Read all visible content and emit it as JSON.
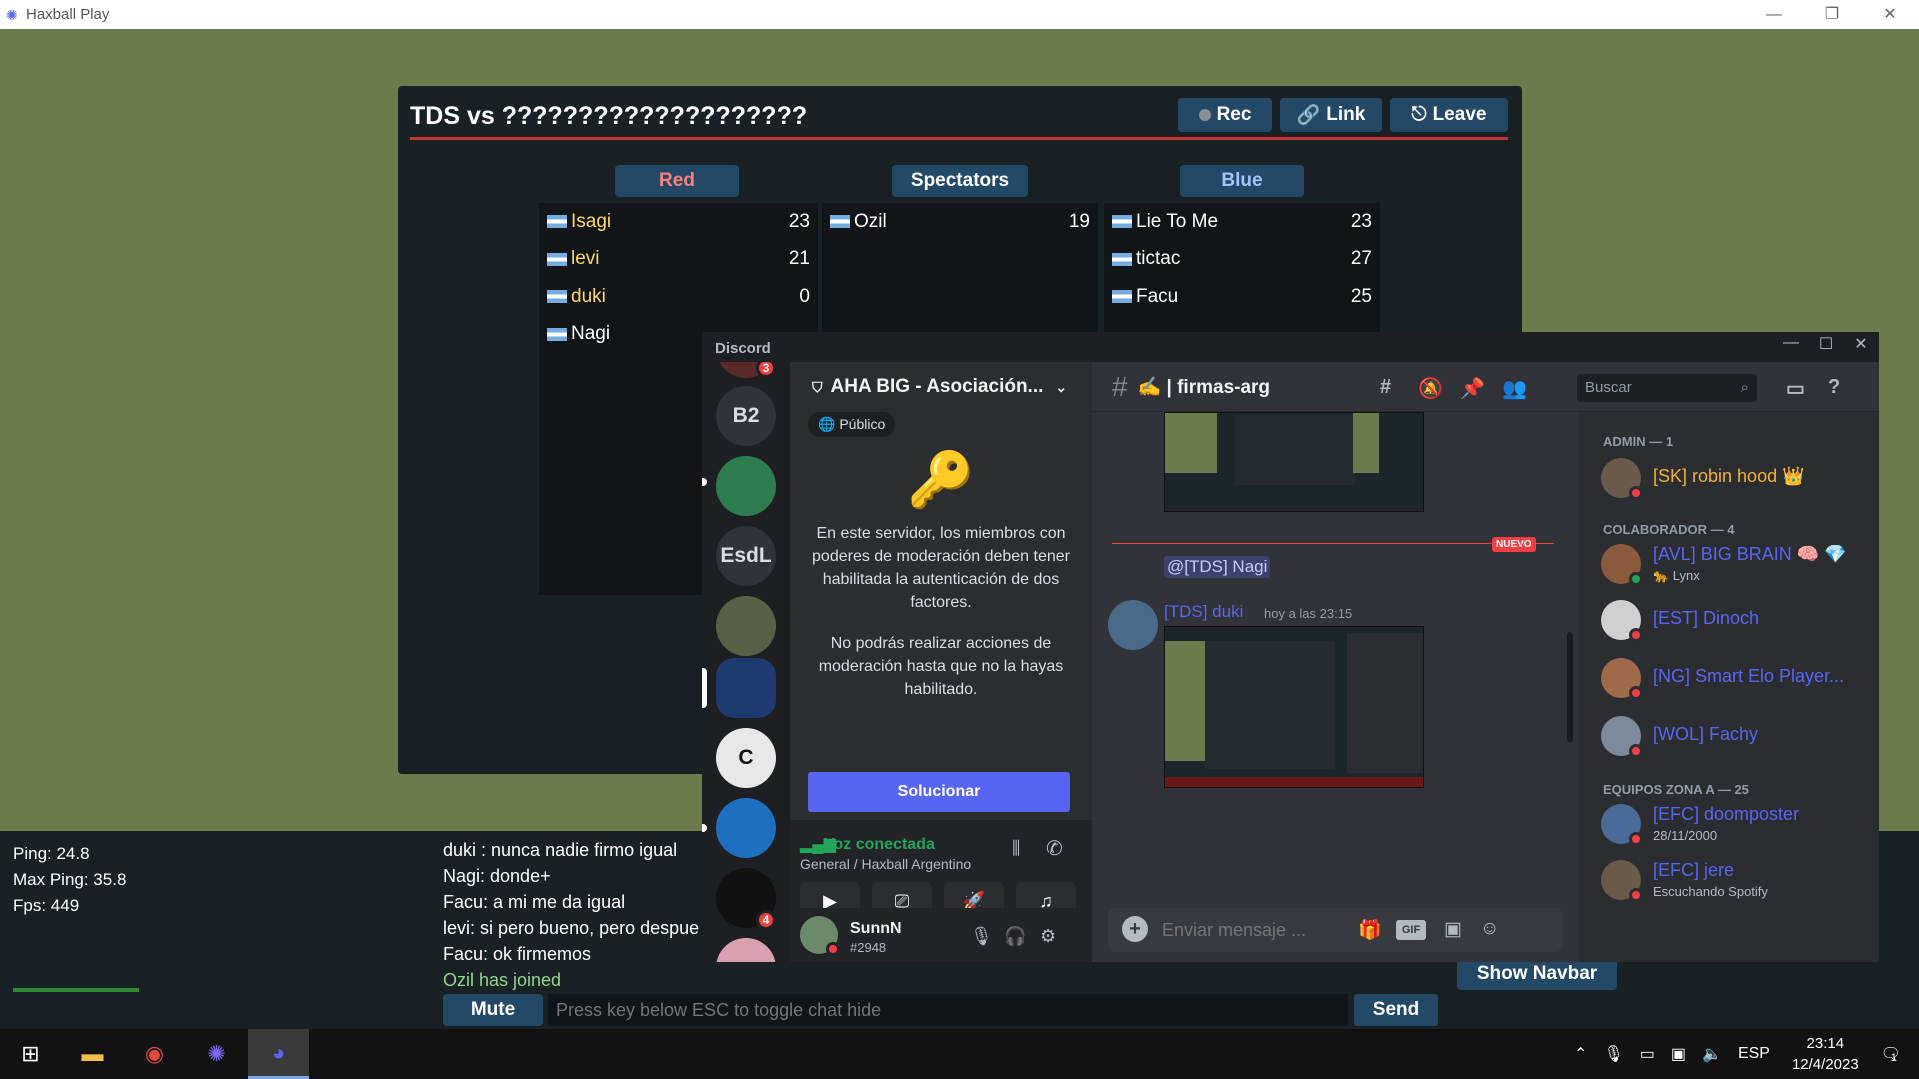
{
  "window": {
    "title": "Haxball Play",
    "controls": [
      "—",
      "❐",
      "✕"
    ]
  },
  "room": {
    "title": "TDS vs ????????????????????",
    "buttons": {
      "rec": "Rec",
      "link": "Link",
      "leave": "Leave"
    },
    "teams": {
      "red": {
        "label": "Red",
        "color": "#ff7f7f",
        "players": [
          {
            "name": "Isagi",
            "value": "23"
          },
          {
            "name": "levi",
            "value": "21"
          },
          {
            "name": "duki",
            "value": "0"
          },
          {
            "name": "Nagi",
            "value": ""
          }
        ]
      },
      "spectators": {
        "label": "Spectators",
        "color": "#ffffff",
        "players": [
          {
            "name": "Ozil",
            "value": "19"
          }
        ]
      },
      "blue": {
        "label": "Blue",
        "color": "#a2c4ff",
        "players": [
          {
            "name": "Lie To Me",
            "value": "23"
          },
          {
            "name": "tictac",
            "value": "27"
          },
          {
            "name": "Facu",
            "value": "25"
          }
        ]
      }
    }
  },
  "hud": {
    "stats": [
      "Ping: 24.8",
      "Max Ping: 35.8",
      "Fps: 449"
    ],
    "chat": [
      {
        "text": "duki : nunca nadie firmo igual",
        "system": false
      },
      {
        "text": "Nagi: donde+",
        "system": false
      },
      {
        "text": "Facu: a mi me da igual",
        "system": false
      },
      {
        "text": "levi: si pero bueno, pero despue",
        "system": false
      },
      {
        "text": "Facu: ok firmemos",
        "system": false
      },
      {
        "text": "Ozil has joined",
        "system": true
      }
    ],
    "mute": "Mute",
    "input_placeholder": "Press key below ESC to toggle chat hide",
    "send": "Send",
    "show_navbar": "Show Navbar"
  },
  "discord": {
    "app_name": "Discord",
    "servers": [
      {
        "label": "B2",
        "color": "#313338",
        "badge": ""
      },
      {
        "label": "",
        "color": "#2e7d4f",
        "badge": ""
      },
      {
        "label": "EsdL",
        "color": "#313338",
        "badge": ""
      },
      {
        "label": "",
        "color": "#5a6046",
        "badge": ""
      },
      {
        "label": "",
        "color": "#1d3b6e",
        "badge": ""
      },
      {
        "label": "C",
        "color": "#e8e8e8",
        "badge": ""
      },
      {
        "label": "",
        "color": "#1f6fc0",
        "badge": ""
      },
      {
        "label": "",
        "color": "#111111",
        "badge": "4"
      }
    ],
    "guild": {
      "name": "AHA BIG - Asociación...",
      "visibility": "Público",
      "notice1": "En este servidor, los miembros con poderes de moderación deben tener habilitada la autenticación de dos factores.",
      "notice2": "No podrás realizar acciones de moderación hasta que no la hayas habilitado.",
      "fix_button": "Solucionar"
    },
    "voice": {
      "status": "Voz conectada",
      "channel": "General / Haxball Argentino"
    },
    "user": {
      "name": "SunnN",
      "tag": "#2948"
    },
    "channel": {
      "name": "✍️ | firmas-arg",
      "search_placeholder": "Buscar"
    },
    "messages": {
      "new_tag": "NUEVO",
      "mention": "@[TDS] Nagi",
      "author": "[TDS] duki",
      "time": "hoy a las 23:15"
    },
    "composer_placeholder": "Enviar mensaje ...",
    "gif_label": "GIF",
    "member_groups": [
      {
        "title": "ADMIN — 1",
        "members": [
          {
            "name": "[SK] robin hood 👑",
            "sub": "",
            "color": "#f0b232",
            "avatar": "#6a5a4a",
            "status": "#f23f43"
          }
        ]
      },
      {
        "title": "COLABORADOR — 4",
        "members": [
          {
            "name": "[AVL] BIG BRAIN 🧠 💎",
            "sub": "🐆 Lynx",
            "color": "#5865f2",
            "avatar": "#8a5a3a",
            "status": "#23a559"
          },
          {
            "name": "[EST] Dinoch",
            "sub": "",
            "color": "#5865f2",
            "avatar": "#d0d0d0",
            "status": "#f23f43"
          },
          {
            "name": "[NG] Smart Elo Player...",
            "sub": "",
            "color": "#5865f2",
            "avatar": "#a06a4a",
            "status": "#f23f43"
          },
          {
            "name": "[WOL] Fachy",
            "sub": "",
            "color": "#5865f2",
            "avatar": "#7a8a9a",
            "status": "#f23f43"
          }
        ]
      },
      {
        "title": "EQUIPOS ZONA A — 25",
        "members": [
          {
            "name": "[EFC] doomposter",
            "sub": "28/11/2000",
            "color": "#5865f2",
            "avatar": "#4a6a9a",
            "status": "#f23f43"
          },
          {
            "name": "[EFC] jere",
            "sub": "Escuchando Spotify",
            "color": "#5865f2",
            "avatar": "#6a5a4a",
            "status": "#f23f43"
          }
        ]
      }
    ]
  },
  "taskbar": {
    "lang": "ESP",
    "time": "23:14",
    "date": "12/4/2023",
    "notif_count": "1"
  }
}
